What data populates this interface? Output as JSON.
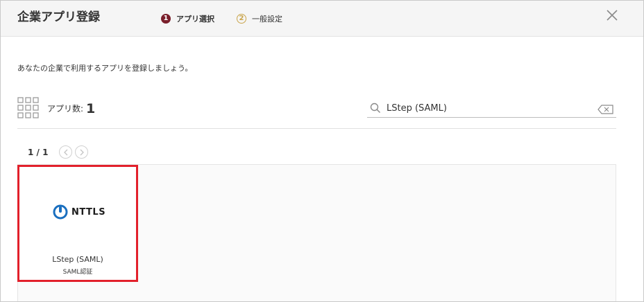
{
  "dialog": {
    "title": "企業アプリ登録",
    "steps": [
      {
        "number": "1",
        "label": "アプリ選択",
        "state": "active"
      },
      {
        "number": "2",
        "label": "一般設定",
        "state": "inactive"
      }
    ],
    "close_icon": "close-icon"
  },
  "main": {
    "description": "あなたの企業で利用するアプリを登録しましょう。",
    "app_count_label": "アプリ数:",
    "app_count": "1",
    "search": {
      "value": "LStep (SAML)",
      "placeholder": ""
    },
    "pager": {
      "text": "1 / 1"
    },
    "apps": [
      {
        "logo_text": "NTTLS",
        "name": "LStep (SAML)",
        "subtitle": "SAML認証",
        "selected": true
      }
    ]
  },
  "colors": {
    "accent": "#7a1f2b",
    "step_inactive": "#c9a44a",
    "selection_border": "#e2202b",
    "logo_blue": "#1a6fbf"
  }
}
